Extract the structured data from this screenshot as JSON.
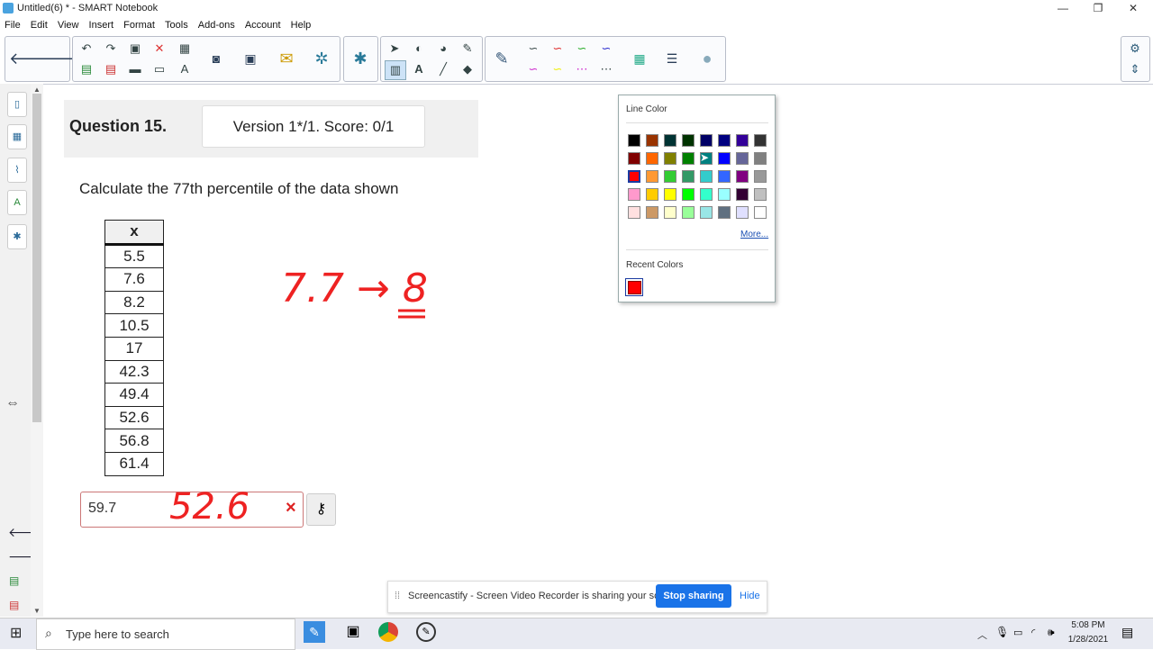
{
  "window": {
    "title": "Untitled(6) * - SMART Notebook",
    "minimize": "—",
    "maximize": "❐",
    "close": "✕"
  },
  "menu": [
    "File",
    "Edit",
    "View",
    "Insert",
    "Format",
    "Tools",
    "Add-ons",
    "Account",
    "Help"
  ],
  "question": {
    "title": "Question 15.",
    "version": "Version 1*/1. Score: 0/1",
    "prompt": "Calculate the 77th percentile of the data shown",
    "table_header": "x",
    "values": [
      "5.5",
      "7.6",
      "8.2",
      "10.5",
      "17",
      "42.3",
      "49.4",
      "52.6",
      "56.8",
      "61.4"
    ],
    "answer": "59.7"
  },
  "handwriting": {
    "computation": "7.7 → 8",
    "correct_answer": "52.6",
    "wrong_mark": "×"
  },
  "color_popup": {
    "title": "Line Color",
    "more": "More...",
    "recent_title": "Recent Colors",
    "selected": "#ff0000",
    "palette": [
      [
        "#000000",
        "#993300",
        "#003333",
        "#003300",
        "#000066",
        "#000080",
        "#330099",
        "#333333"
      ],
      [
        "#800000",
        "#ff6600",
        "#808000",
        "#008000",
        "#008080",
        "#0000ff",
        "#666699",
        "#808080"
      ],
      [
        "#ff0000",
        "#ff9933",
        "#33cc33",
        "#339966",
        "#33cccc",
        "#3366ff",
        "#800080",
        "#999999"
      ],
      [
        "#ff99cc",
        "#ffcc00",
        "#ffff00",
        "#00ff00",
        "#33ffcc",
        "#99ffff",
        "#330033",
        "#c0c0c0"
      ],
      [
        "#ffe0e0",
        "#cc9966",
        "#ffffcc",
        "#99ff99",
        "#99e6e6",
        "#607080",
        "#e0e0ff",
        "#ffffff"
      ]
    ],
    "recent": [
      "#ff0000"
    ]
  },
  "share_bar": {
    "message": "Screencastify - Screen Video Recorder is sharing your screen.",
    "stop": "Stop sharing",
    "hide": "Hide"
  },
  "taskbar": {
    "search_placeholder": "Type here to search",
    "time": "5:08 PM",
    "date": "1/28/2021"
  }
}
